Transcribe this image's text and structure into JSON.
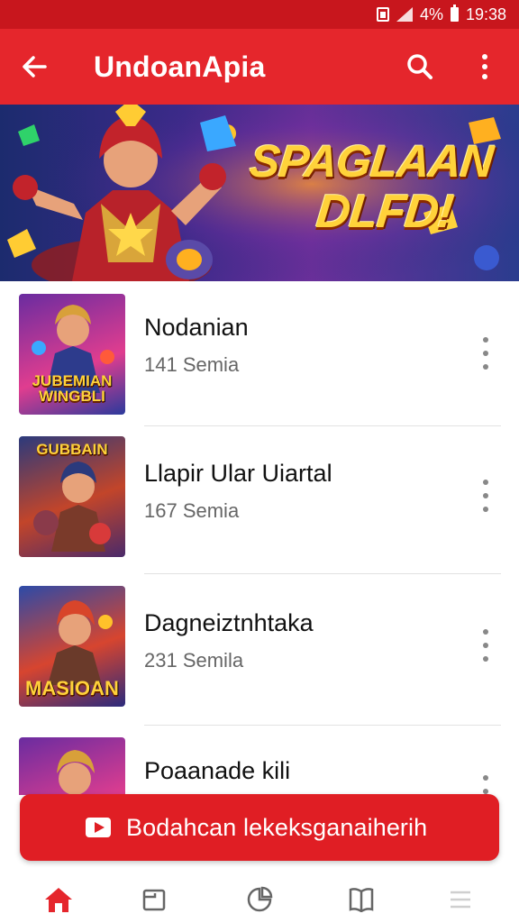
{
  "status_bar": {
    "battery_percent": "4%",
    "time": "19:38",
    "icons": [
      "sim-icon",
      "signal-icon",
      "battery-icon"
    ]
  },
  "app_bar": {
    "title": "UndoanApia",
    "icons": [
      "back-arrow-icon",
      "search-icon",
      "more-vert-icon"
    ]
  },
  "banner": {
    "line1": "SPAGLAAN",
    "line2": "DLFD!"
  },
  "games": [
    {
      "title": "Nodanian",
      "subtitle": "141 Semia",
      "thumb_caption": "JUBEMIAN WINGBLI",
      "thumb_colors": [
        "#6a2ca0",
        "#e03d8f"
      ]
    },
    {
      "title": "Llapir Ular Uiartal",
      "subtitle": "167 Semia",
      "thumb_caption": "GUBBAIN",
      "thumb_colors": [
        "#2b3a7c",
        "#c2452a"
      ]
    },
    {
      "title": "Dagneiztnhtaka",
      "subtitle": "231 Semila",
      "thumb_caption": "MASIOAN",
      "thumb_colors": [
        "#2c4aa8",
        "#d7452f"
      ]
    },
    {
      "title": "Poaanade kili",
      "subtitle": "",
      "thumb_caption": "",
      "thumb_colors": [
        "#6a2ca0",
        "#e03d8f"
      ]
    }
  ],
  "cta": {
    "label": "Bodahcan lekeksganaiherih",
    "icon": "play-icon"
  },
  "bottom_nav": [
    "home-icon",
    "library-icon",
    "explore-icon",
    "book-icon",
    "list-icon"
  ],
  "colors": {
    "primary": "#e5262c",
    "status_bar": "#c8161d",
    "cta": "#e01e24"
  }
}
